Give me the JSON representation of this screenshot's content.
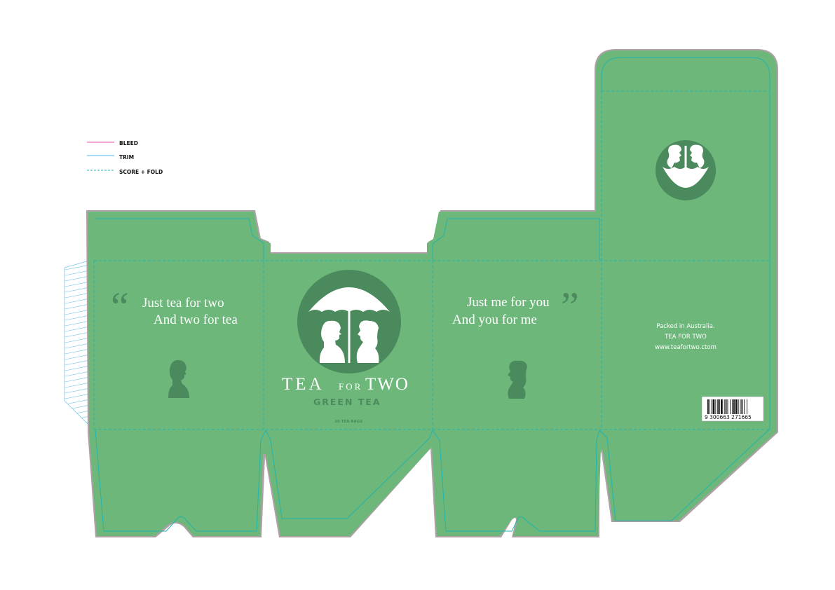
{
  "legend": {
    "bleed_label": "BLEED",
    "trim_label": "TRIM",
    "score_label": "SCORE + FOLD"
  },
  "colors": {
    "panel": "#6db77a",
    "bleed_border": "#b0a0a8",
    "trim": "#1fb5ad",
    "dark_green": "#4b8a5d",
    "bleed_legend": "#e64fa6",
    "trim_legend": "#4fb4e6",
    "glue_hatch": "#7cc8e8"
  },
  "quote_left": {
    "mark": "“",
    "line1": "Just tea for two",
    "line2": "And two for tea"
  },
  "front": {
    "brand_word1": "TEA",
    "brand_word2": "FOR",
    "brand_word3": "TWO",
    "product": "GREEN TEA",
    "count": "20 TEA BAGS"
  },
  "quote_right": {
    "mark": "”",
    "line1": "Just me for you",
    "line2": "And you for me"
  },
  "back": {
    "line1": "Packed in Australia.",
    "line2": "TEA FOR TWO",
    "line3": "www.teafortwo.ctom",
    "barcode_digits": "9 300663 271665"
  },
  "icons": {
    "front_logo": "umbrella-couple-logo-icon",
    "top_logo": "couple-silhouette-logo-icon",
    "man": "man-silhouette-icon",
    "woman": "woman-silhouette-icon",
    "barcode": "barcode-icon"
  }
}
